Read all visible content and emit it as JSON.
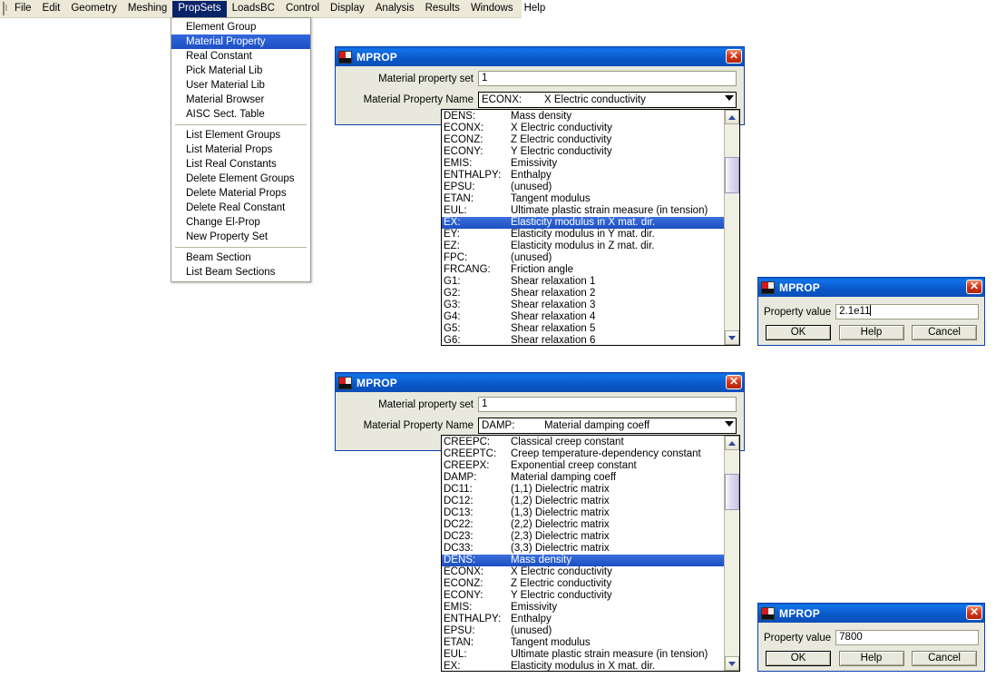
{
  "menubar": {
    "app_icon": "document-icon",
    "items": [
      {
        "label": "File",
        "active": false
      },
      {
        "label": "Edit",
        "active": false
      },
      {
        "label": "Geometry",
        "active": false
      },
      {
        "label": "Meshing",
        "active": false
      },
      {
        "label": "PropSets",
        "active": true
      },
      {
        "label": "LoadsBC",
        "active": false
      },
      {
        "label": "Control",
        "active": false
      },
      {
        "label": "Display",
        "active": false
      },
      {
        "label": "Analysis",
        "active": false
      },
      {
        "label": "Results",
        "active": false
      },
      {
        "label": "Windows",
        "active": false
      },
      {
        "label": "Help",
        "active": false
      }
    ]
  },
  "dropdown": {
    "groups": [
      [
        {
          "label": "Element Group",
          "selected": false
        },
        {
          "label": "Material Property",
          "selected": true
        },
        {
          "label": "Real Constant",
          "selected": false
        },
        {
          "label": "Pick Material Lib",
          "selected": false
        },
        {
          "label": "User Material Lib",
          "selected": false
        },
        {
          "label": "Material Browser",
          "selected": false
        },
        {
          "label": "AISC Sect. Table",
          "selected": false
        }
      ],
      [
        {
          "label": "List Element Groups",
          "selected": false
        },
        {
          "label": "List Material Props",
          "selected": false
        },
        {
          "label": "List Real Constants",
          "selected": false
        },
        {
          "label": "Delete Element Groups",
          "selected": false
        },
        {
          "label": "Delete Material Props",
          "selected": false
        },
        {
          "label": "Delete Real Constant",
          "selected": false
        },
        {
          "label": "Change El-Prop",
          "selected": false
        },
        {
          "label": "New Property Set",
          "selected": false
        }
      ],
      [
        {
          "label": "Beam Section",
          "selected": false
        },
        {
          "label": "List Beam Sections",
          "selected": false
        }
      ]
    ]
  },
  "dialog1": {
    "title": "MPROP",
    "close_icon": "close-icon",
    "set_label": "Material property set",
    "set_value": "1",
    "name_label": "Material Property Name",
    "combo_code": "ECONX:",
    "combo_desc": "X Electric conductivity",
    "list": [
      {
        "code": "DENS:",
        "desc": "Mass density",
        "selected": false
      },
      {
        "code": "ECONX:",
        "desc": "X Electric conductivity",
        "selected": false
      },
      {
        "code": "ECONZ:",
        "desc": "Z Electric conductivity",
        "selected": false
      },
      {
        "code": "ECONY:",
        "desc": "Y Electric conductivity",
        "selected": false
      },
      {
        "code": "EMIS:",
        "desc": "Emissivity",
        "selected": false
      },
      {
        "code": "ENTHALPY:",
        "desc": "Enthalpy",
        "selected": false
      },
      {
        "code": "EPSU:",
        "desc": "(unused)",
        "selected": false
      },
      {
        "code": "ETAN:",
        "desc": "Tangent modulus",
        "selected": false
      },
      {
        "code": "EUL:",
        "desc": "Ultimate plastic strain measure (in tension)",
        "selected": false
      },
      {
        "code": "EX:",
        "desc": "Elasticity modulus in X mat. dir.",
        "selected": true
      },
      {
        "code": "EY:",
        "desc": "Elasticity modulus in Y mat. dir.",
        "selected": false
      },
      {
        "code": "EZ:",
        "desc": "Elasticity modulus in Z mat. dir.",
        "selected": false
      },
      {
        "code": "FPC:",
        "desc": "(unused)",
        "selected": false
      },
      {
        "code": "FRCANG:",
        "desc": "Friction angle",
        "selected": false
      },
      {
        "code": "G1:",
        "desc": "Shear relaxation 1",
        "selected": false
      },
      {
        "code": "G2:",
        "desc": "Shear relaxation 2",
        "selected": false
      },
      {
        "code": "G3:",
        "desc": "Shear relaxation 3",
        "selected": false
      },
      {
        "code": "G4:",
        "desc": "Shear relaxation 4",
        "selected": false
      },
      {
        "code": "G5:",
        "desc": "Shear relaxation 5",
        "selected": false
      },
      {
        "code": "G6:",
        "desc": "Shear relaxation 6",
        "selected": false
      }
    ]
  },
  "dialog2": {
    "title": "MPROP",
    "close_icon": "close-icon",
    "set_label": "Material property set",
    "set_value": "1",
    "name_label": "Material Property Name",
    "combo_code": "DAMP:",
    "combo_desc": "Material damping coeff",
    "list": [
      {
        "code": "CREEPC:",
        "desc": "Classical creep constant",
        "selected": false
      },
      {
        "code": "CREEPTC:",
        "desc": "Creep temperature-dependency constant",
        "selected": false
      },
      {
        "code": "CREEPX:",
        "desc": "Exponential creep constant",
        "selected": false
      },
      {
        "code": "DAMP:",
        "desc": "Material damping coeff",
        "selected": false
      },
      {
        "code": "DC11:",
        "desc": "(1,1) Dielectric matrix",
        "selected": false
      },
      {
        "code": "DC12:",
        "desc": "(1,2) Dielectric matrix",
        "selected": false
      },
      {
        "code": "DC13:",
        "desc": "(1,3) Dielectric matrix",
        "selected": false
      },
      {
        "code": "DC22:",
        "desc": "(2,2) Dielectric matrix",
        "selected": false
      },
      {
        "code": "DC23:",
        "desc": "(2,3) Dielectric matrix",
        "selected": false
      },
      {
        "code": "DC33:",
        "desc": "(3,3) Dielectric matrix",
        "selected": false
      },
      {
        "code": "DENS:",
        "desc": "Mass density",
        "selected": true
      },
      {
        "code": "ECONX:",
        "desc": "X Electric conductivity",
        "selected": false
      },
      {
        "code": "ECONZ:",
        "desc": "Z Electric conductivity",
        "selected": false
      },
      {
        "code": "ECONY:",
        "desc": "Y Electric conductivity",
        "selected": false
      },
      {
        "code": "EMIS:",
        "desc": "Emissivity",
        "selected": false
      },
      {
        "code": "ENTHALPY:",
        "desc": "Enthalpy",
        "selected": false
      },
      {
        "code": "EPSU:",
        "desc": "(unused)",
        "selected": false
      },
      {
        "code": "ETAN:",
        "desc": "Tangent modulus",
        "selected": false
      },
      {
        "code": "EUL:",
        "desc": "Ultimate plastic strain measure (in tension)",
        "selected": false
      },
      {
        "code": "EX:",
        "desc": "Elasticity modulus in X mat. dir.",
        "selected": false
      }
    ]
  },
  "value_dialog1": {
    "title": "MPROP",
    "close_icon": "close-icon",
    "label": "Property value",
    "value": "2.1e11",
    "ok_label": "OK",
    "help_label": "Help",
    "cancel_label": "Cancel"
  },
  "value_dialog2": {
    "title": "MPROP",
    "close_icon": "close-icon",
    "label": "Property value",
    "value": "7800",
    "ok_label": "OK",
    "help_label": "Help",
    "cancel_label": "Cancel"
  },
  "colors": {
    "menubar_bg": "#ece9d8",
    "menu_highlight": "#0a246a",
    "dialog_bg": "#e8e9dc",
    "titlebar_blue": "#0a57c8",
    "selection_blue": "#2a5fd4",
    "close_red": "#d8391b"
  }
}
